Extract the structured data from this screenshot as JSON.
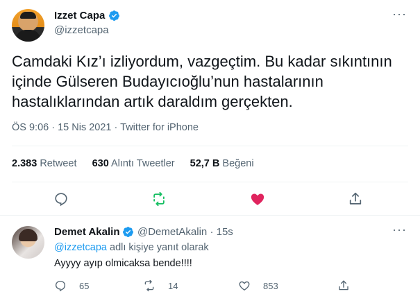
{
  "tweet": {
    "author_name": "Izzet Capa",
    "author_handle": "@izzetcapa",
    "more_label": "···",
    "text": "Camdaki Kız’ı izliyordum, vazgeçtim. Bu kadar sıkıntının içinde Gülseren Budayıcıoğlu’nun hastalarının hastalıklarından artık daraldım gerçekten.",
    "time": "ÖS 9:06",
    "date": "15 Nis 2021",
    "separator": "·",
    "source": "Twitter for iPhone",
    "stats": {
      "retweets_count": "2.383",
      "retweets_label": "Retweet",
      "quotes_count": "630",
      "quotes_label": "Alıntı Tweetler",
      "likes_count": "52,7 B",
      "likes_label": "Beğeni"
    },
    "colors": {
      "retweet": "#17bf63",
      "like": "#e0245e",
      "icon": "#536471",
      "verified": "#1d9bf0"
    }
  },
  "reply": {
    "author_name": "Demet Akalin",
    "author_handle": "@DemetAkalin",
    "time": "15s",
    "separator": "·",
    "more_label": "···",
    "replying_mention": "@izzetcapa",
    "replying_suffix": "adlı kişiye yanıt olarak",
    "text": "Ayyyy ayıp olmicaksa bende!!!!",
    "reply_count": "65",
    "retweet_count": "14",
    "like_count": "853"
  }
}
